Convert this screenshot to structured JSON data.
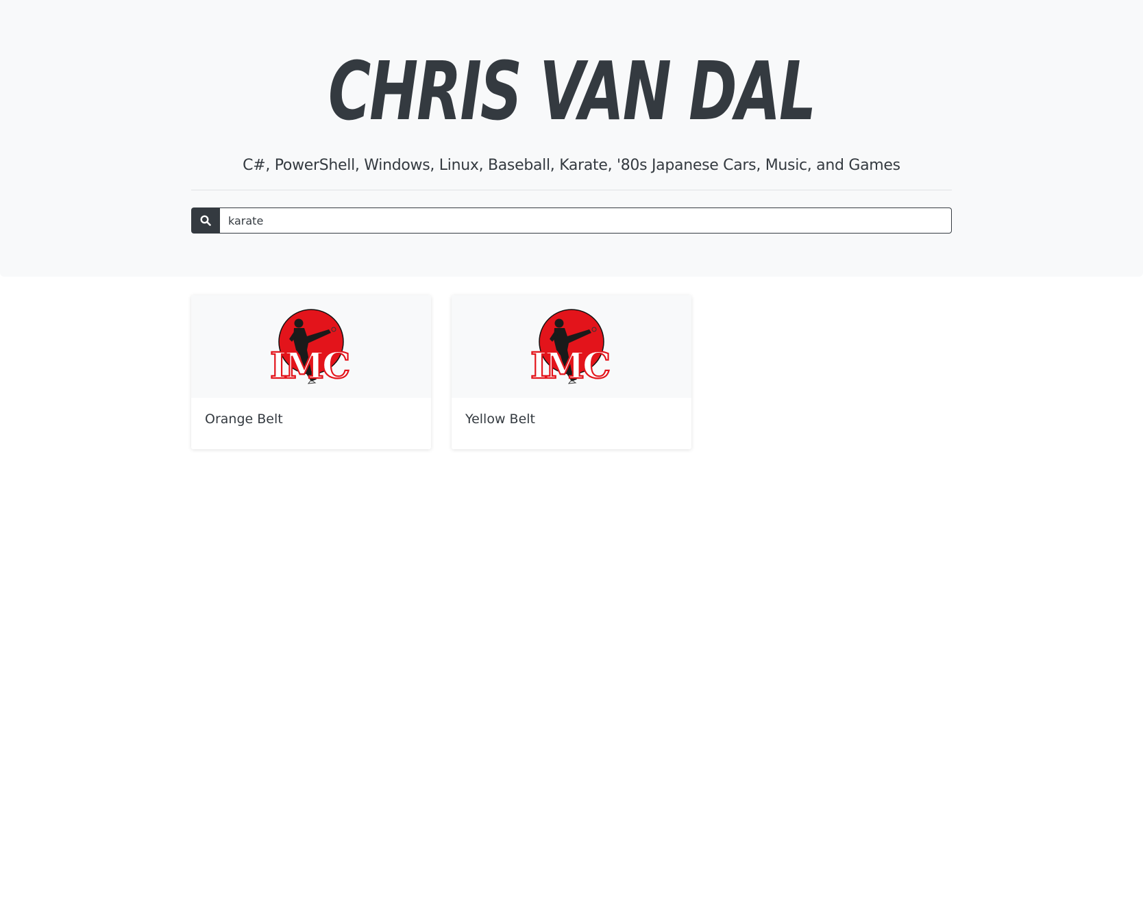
{
  "header": {
    "title": "CHRIS VAN DAL",
    "subtitle": "C#, PowerShell, Windows, Linux, Baseball, Karate, '80s Japanese Cars, Music, and Games"
  },
  "search": {
    "icon": "search-icon",
    "value": "karate",
    "placeholder": ""
  },
  "results": [
    {
      "title": "Orange Belt",
      "image": "imc-karate-logo",
      "logo_text": "IMC"
    },
    {
      "title": "Yellow Belt",
      "image": "imc-karate-logo",
      "logo_text": "IMC"
    }
  ],
  "colors": {
    "header_bg": "#f8f9fa",
    "dark": "#343a40",
    "logo_red": "#e3141b"
  }
}
